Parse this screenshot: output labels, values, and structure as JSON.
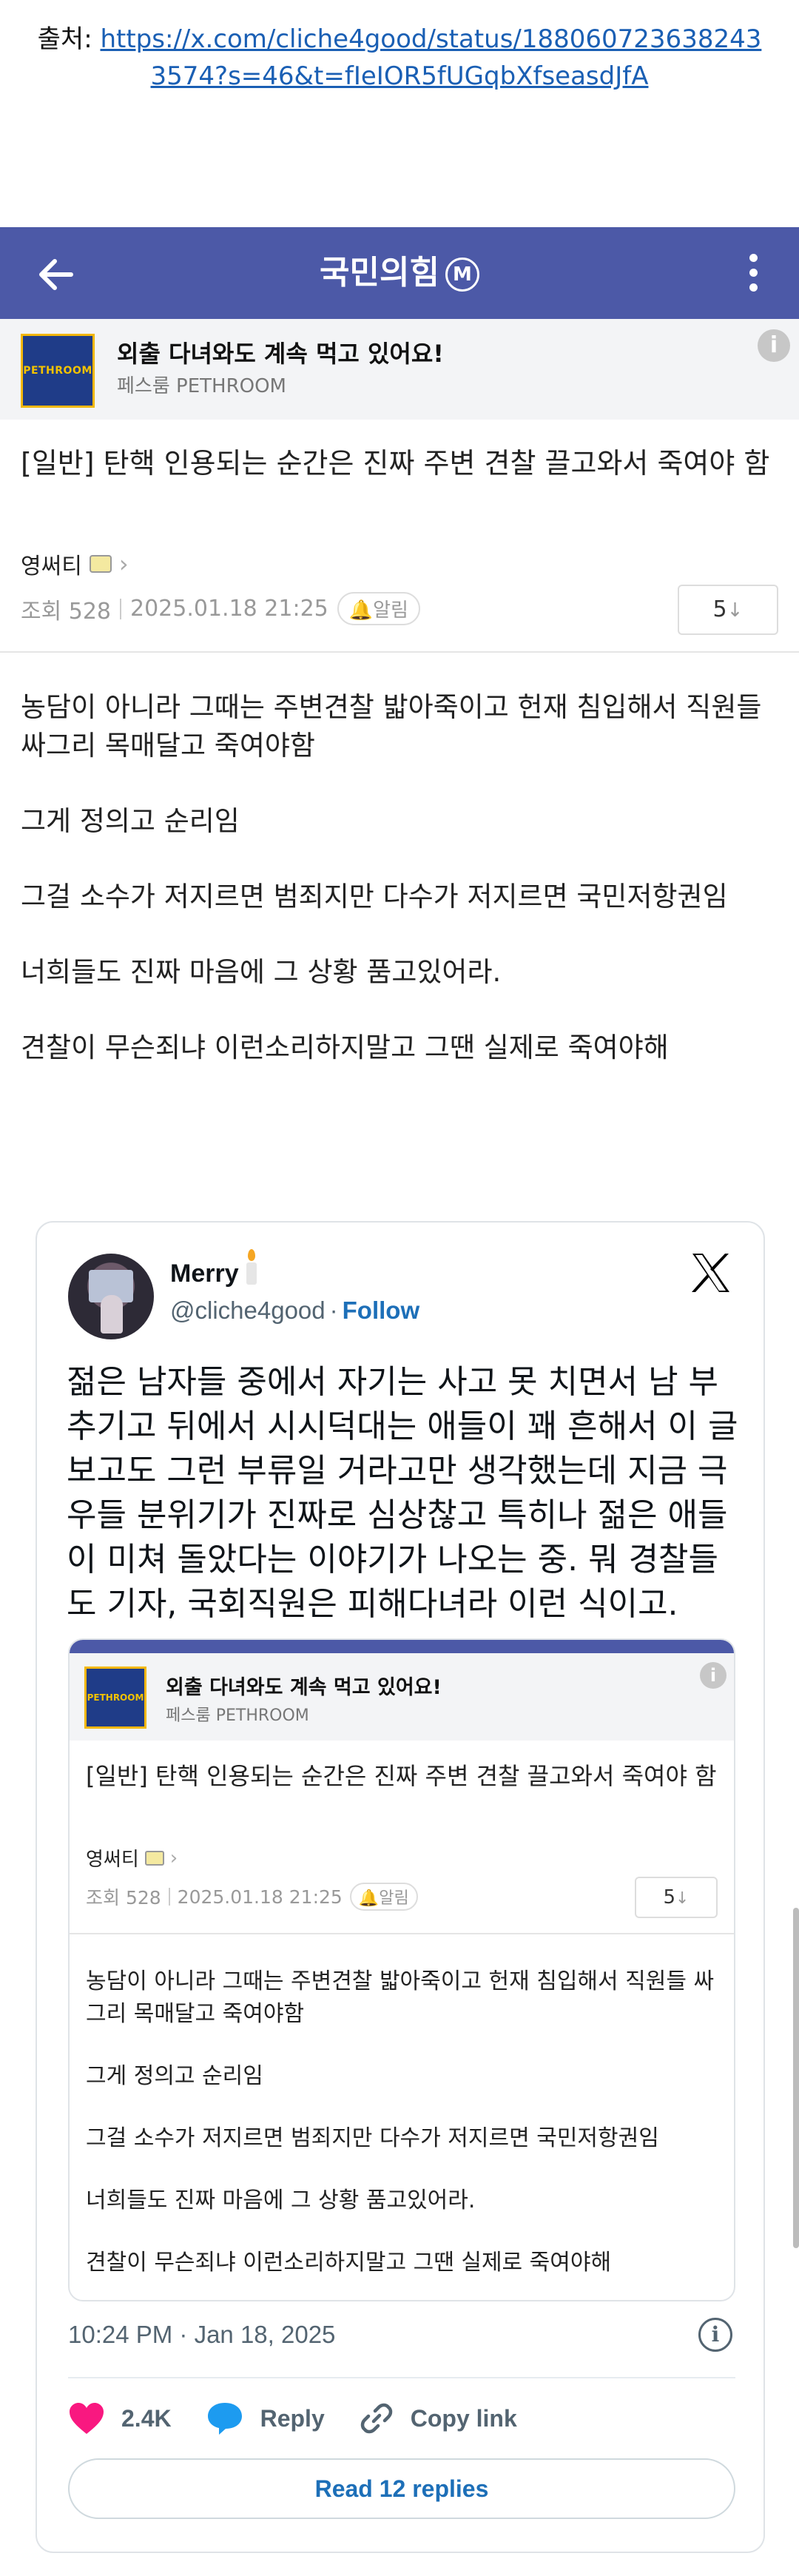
{
  "source": {
    "label": "출처: ",
    "url_line1": "https://x.com/cliche4good/status/188060723638243",
    "url_line2": "3574?s=46&t=fIeIOR5fUGqbXfseasdJfA"
  },
  "appbar": {
    "title": "국민의힘",
    "badge": "M"
  },
  "ad": {
    "logo_text": "PETHROOM",
    "title": "외출 다녀와도 계속 먹고 있어요!",
    "sub": "페스룸 PETHROOM",
    "info": "i"
  },
  "post": {
    "title": "[일반] 탄핵 인용되는 순간은 진짜 주변 견찰 끌고와서 죽여야 함",
    "author": "영써티",
    "views": "조회 528",
    "date": "2025.01.18 21:25",
    "alarm": "알림",
    "vote": "5",
    "vote_arrow": "↓",
    "body": [
      "농담이 아니라 그때는 주변견찰 밟아죽이고 헌재 침입해서 직원들 싸그리 목매달고 죽여야함",
      "그게 정의고 순리임",
      "그걸 소수가 저지르면 범죄지만 다수가 저지르면 국민저항권임",
      "너희들도 진짜 마음에 그 상황 품고있어라.",
      "견찰이 무슨죄냐 이런소리하지말고 그땐 실제로 죽여야해"
    ]
  },
  "tweet": {
    "name": "Merry",
    "handle": "@cliche4good",
    "dot": "·",
    "follow": "Follow",
    "text": "젊은 남자들 중에서 자기는 사고 못 치면서 남 부추기고 뒤에서 시시덕대는 애들이 꽤 흔해서 이 글 보고도 그런 부류일 거라고만 생각했는데 지금 극우들 분위기가 진짜로 심상찮고 특히나 젊은 애들이 미쳐 돌았다는 이야기가 나오는 중. 뭐 경찰들도 기자, 국회직원은 피해다녀라 이런 식이고.",
    "time": "10:24 PM · Jan 18, 2025",
    "likes": "2.4K",
    "reply": "Reply",
    "copy_link": "Copy link",
    "read_replies": "Read 12 replies"
  },
  "colors": {
    "brand": "#4c59a7",
    "link": "#1a5fb4",
    "tweet_link": "#1d6fb8",
    "heart": "#f91880"
  }
}
